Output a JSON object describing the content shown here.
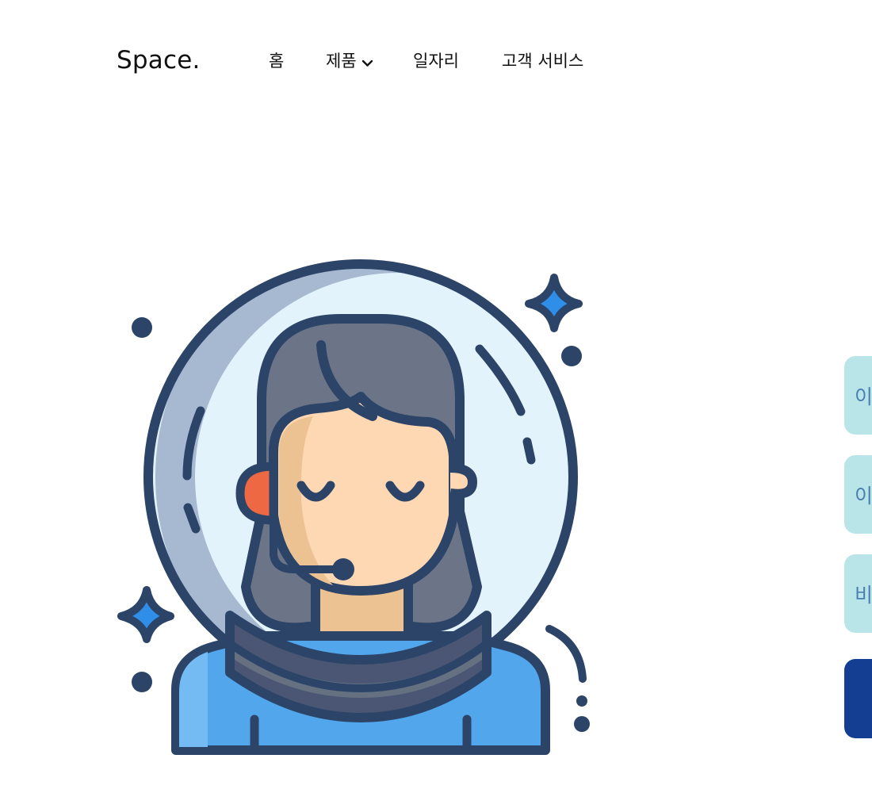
{
  "header": {
    "logo": "Space.",
    "nav": [
      {
        "label": "홈"
      },
      {
        "label": "제품",
        "icon": "chevron-down-icon"
      },
      {
        "label": "일자리"
      },
      {
        "label": "고객 서비스"
      }
    ]
  },
  "illustration": {
    "icon": "astronaut-support-agent-illustration"
  },
  "side_buttons": [
    {
      "label": "이"
    },
    {
      "label": "이"
    },
    {
      "label": "비"
    },
    {
      "label": ""
    }
  ],
  "colors": {
    "outline": "#2b4468",
    "helmet_glass": "#e2f3fb",
    "helmet_shade": "#a7b8d1",
    "hair": "#6c7487",
    "skin": "#fed7b3",
    "skin_shade": "#edc293",
    "headset_ear": "#ee6843",
    "suit": "#52a6ec",
    "suit_light": "#74bbf3",
    "collar": "#657081",
    "collar_dark": "#4a5673",
    "sparkle": "#2f8fe8",
    "side_light": "#b9e5e9",
    "side_dark": "#133e92"
  }
}
